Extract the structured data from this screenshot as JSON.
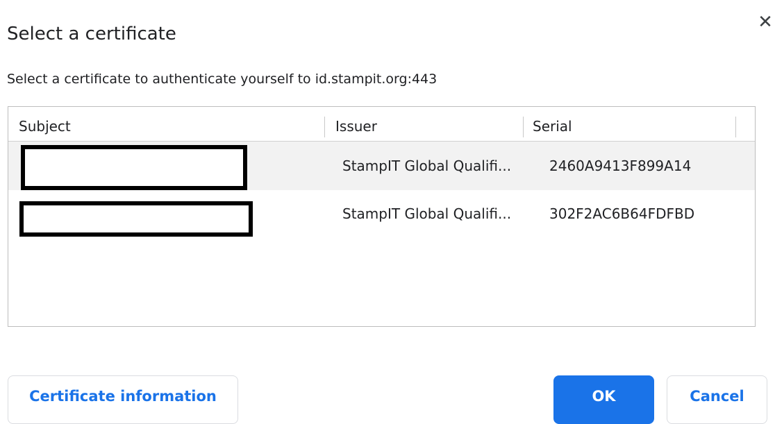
{
  "dialog": {
    "title": "Select a certificate",
    "subtitle": "Select a certificate to authenticate yourself to id.stampit.org:443",
    "close_icon": "close-icon"
  },
  "table": {
    "columns": [
      "Subject",
      "Issuer",
      "Serial"
    ],
    "rows": [
      {
        "subject": "",
        "issuer": "StampIT Global Qualifi...",
        "serial": "2460A9413F899A14",
        "selected": true
      },
      {
        "subject": "",
        "issuer": "StampIT Global Qualifi...",
        "serial": "302F2AC6B64FDFBD",
        "selected": false
      }
    ]
  },
  "buttons": {
    "certificate_info": "Certificate information",
    "ok": "OK",
    "cancel": "Cancel"
  },
  "colors": {
    "accent": "#1a73e8",
    "selected_row": "#f2f2f2"
  }
}
